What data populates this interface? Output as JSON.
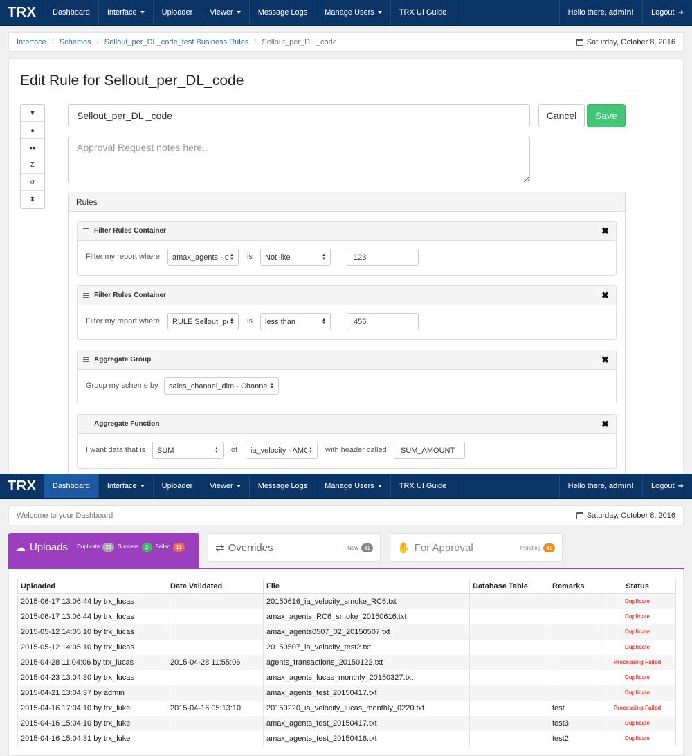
{
  "nav": {
    "brand": "TRX",
    "items": [
      "Dashboard",
      "Interface",
      "Uploader",
      "Viewer",
      "Message Logs",
      "Manage Users",
      "TRX UI Guide"
    ],
    "greeting": "Hello there,",
    "user": "admin!",
    "logout": "Logout"
  },
  "breadcrumb": [
    "Interface",
    "Schemes",
    "Sellout_per_DL_code_test Business Rules",
    "Sellout_per_DL _code"
  ],
  "date": "Saturday, October 8, 2016",
  "edit": {
    "title": "Edit Rule for Sellout_per_DL_code",
    "name_value": "Sellout_per_DL _code",
    "cancel": "Cancel",
    "save": "Save",
    "notes_placeholder": "Approval Request notes here..",
    "rules_heading": "Rules"
  },
  "toolbar_icons": [
    "filter-icon",
    "tag-icon",
    "tags-icon",
    "sigma-icon",
    "sigma-lowercase-icon",
    "sort-icon"
  ],
  "toolbar_glyphs": [
    "▼",
    "●",
    "●●",
    "Σ",
    "σ",
    "⬍"
  ],
  "rules": [
    {
      "heading": "Filter Rules Container",
      "prefix": "Filter my report where",
      "field": "amax_agents - cip",
      "op_label": "is",
      "operator": "Not like",
      "value": "123"
    },
    {
      "heading": "Filter Rules Container",
      "prefix": "Filter my report where",
      "field": "RULE Sellout_per_",
      "op_label": "is",
      "operator": "less than",
      "value": "456"
    },
    {
      "heading": "Aggregate Group",
      "prefix": "Group my scheme by",
      "field": "sales_channel_dim - Channel_ID"
    },
    {
      "heading": "Aggregate Function",
      "prefix": "I want data that is",
      "func": "SUM",
      "of_label": "of",
      "field": "ia_velocity - AMOUNT",
      "header_label": "with header called",
      "header": "SUM_AMOUNT"
    }
  ],
  "dashboard": {
    "welcome": "Welcome to your Dashboard",
    "tabs": {
      "uploads": {
        "title": "Uploads",
        "dup_label": "Duplicate",
        "dup": "23",
        "succ_label": "Success",
        "succ": "2",
        "fail_label": "Failed",
        "fail": "11"
      },
      "overrides": {
        "title": "Overrides",
        "new_label": "New",
        "new": "41"
      },
      "approval": {
        "title": "For Approval",
        "pending_label": "Pending",
        "pending": "41"
      }
    },
    "colors": {
      "uploads_tab": "#9b3fbf",
      "navbar": "#0b3567",
      "save": "#45c577",
      "status_text": "#e0443a"
    },
    "columns": [
      "Uploaded",
      "Date Validated",
      "File",
      "Database Table",
      "Remarks",
      "Status"
    ],
    "rows": [
      [
        "2015-06-17 13:06:44 by trx_lucas",
        "",
        "20150616_ia_velocity_smoke_RC6.txt",
        "",
        "",
        "Duplicate"
      ],
      [
        "2015-06-17 13:06:44 by trx_lucas",
        "",
        "amax_agents_RC6_smoke_20150616.txt",
        "",
        "",
        "Duplicate"
      ],
      [
        "2015-05-12 14:05:10 by trx_lucas",
        "",
        "amax_agents0507_02_20150507.txt",
        "",
        "",
        "Duplicate"
      ],
      [
        "2015-05-12 14:05:10 by trx_lucas",
        "",
        "20150507_ia_velocity_test2.txt",
        "",
        "",
        "Duplicate"
      ],
      [
        "2015-04-28 11:04:06 by trx_lucas",
        "2015-04-28 11:55:06",
        "agents_transactions_20150122.txt",
        "",
        "",
        "Processing Failed"
      ],
      [
        "2015-04-23 13:04:30 by trx_lucas",
        "",
        "amax_agents_lucas_monthly_20150327.txt",
        "",
        "",
        "Duplicate"
      ],
      [
        "2015-04-21 13:04:37 by admin",
        "",
        "amax_agents_test_20150417.txt",
        "",
        "",
        "Duplicate"
      ],
      [
        "2015-04-16 17:04:10 by trx_luke",
        "2015-04-16 05:13:10",
        "20150220_ia_velocity_lucas_monthly_0220.txt",
        "",
        "test",
        "Processing Failed"
      ],
      [
        "2015-04-16 15:04:10 by trx_luke",
        "",
        "amax_agents_test_20150417.txt",
        "",
        "test3",
        "Duplicate"
      ],
      [
        "2015-04-16 15:04:31 by trx_luke",
        "",
        "amax_agents_test_20150416.txt",
        "",
        "test2",
        "Duplicate"
      ]
    ]
  }
}
